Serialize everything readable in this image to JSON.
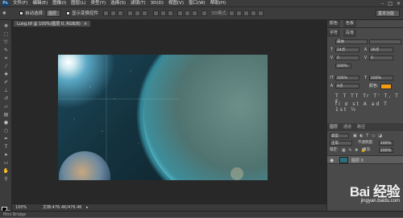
{
  "menubar": {
    "logo": "Ps",
    "items": [
      "文件(F)",
      "编辑(E)",
      "图像(I)",
      "图层(L)",
      "类型(Y)",
      "选择(S)",
      "滤镜(T)",
      "3D(D)",
      "视图(V)",
      "窗口(W)",
      "帮助(H)"
    ],
    "window_controls": [
      "–",
      "□",
      "×"
    ]
  },
  "options": {
    "auto_select_label": "自动选择：",
    "auto_select_value": "图层",
    "show_transform_label": "显示变换控件",
    "workspace": "基本功能"
  },
  "document": {
    "tab_title": "Lung.tif @ 100%(图层 0, RGB/8)",
    "tab_close": "×",
    "zoom": "100%",
    "doc_info": "文档:476.4K/476.4K"
  },
  "right_panel": {
    "tabs": [
      "颜色",
      "色板"
    ],
    "char_tabs": [
      "字符",
      "段落"
    ],
    "font_family": "宋体",
    "font_size": "24点",
    "leading": "36点",
    "kerning": "0",
    "tracking": "0",
    "vscale": "100%",
    "hscale": "100%",
    "baseline": "0点",
    "color_label": "颜色:",
    "text_color": "#f39c12",
    "layers_tabs": [
      "图层",
      "通道",
      "路径"
    ],
    "kind_label": "类型",
    "blend_mode": "正常",
    "opacity_label": "不透明度:",
    "opacity": "100%",
    "lock_label": "锁定:",
    "fill_label": "填充:",
    "fill": "100%",
    "layer_name": "图层 0"
  },
  "watermark": {
    "main": "Bai 经验",
    "sub": "jingyan.baidu.com"
  },
  "colors": {
    "accent_orange": "#f39c12",
    "canvas_teal": "#1c4a5e"
  }
}
